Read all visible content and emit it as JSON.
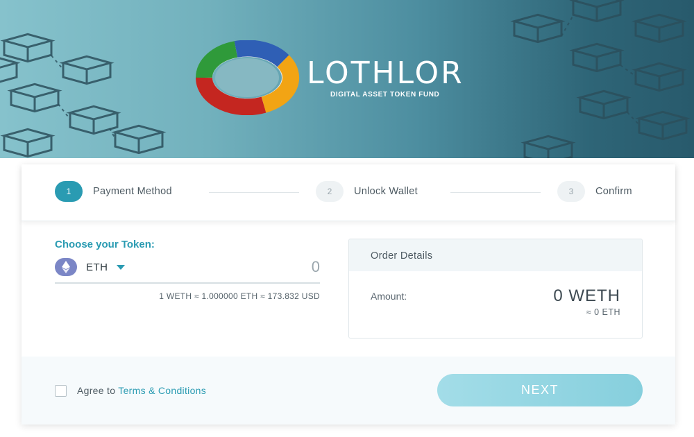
{
  "brand": {
    "name": "LOTHLOR",
    "tagline": "DIGITAL ASSET TOKEN FUND"
  },
  "steps": [
    {
      "number": "1",
      "label": "Payment Method",
      "active": true
    },
    {
      "number": "2",
      "label": "Unlock Wallet",
      "active": false
    },
    {
      "number": "3",
      "label": "Confirm",
      "active": false
    }
  ],
  "payment": {
    "choose_label": "Choose your Token:",
    "token": {
      "symbol": "ETH",
      "icon": "ethereum-icon"
    },
    "amount_value": "0",
    "rate": "1 WETH ≈ 1.000000 ETH ≈ 173.832 USD"
  },
  "order": {
    "title": "Order Details",
    "amount_label": "Amount:",
    "amount_value": "0 WETH",
    "amount_eth": "≈ 0 ETH"
  },
  "footer": {
    "agree_prefix": "Agree to",
    "terms_link": "Terms & Conditions",
    "next_label": "NEXT"
  },
  "colors": {
    "accent": "#2a9bb2",
    "next_button": "#94d6e2",
    "hero_left": "#86c2cc",
    "hero_right": "#285a6c"
  }
}
